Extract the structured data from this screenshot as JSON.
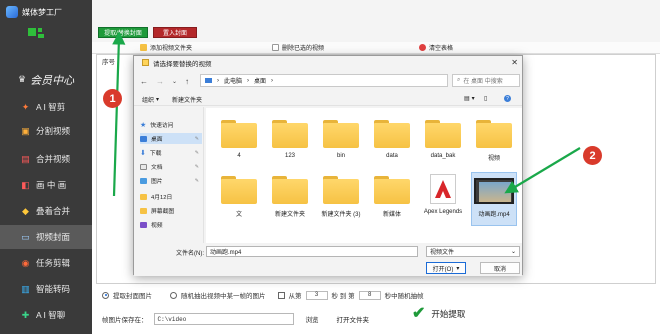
{
  "app": {
    "title": "媒体梦工厂",
    "member_label": "会员中心"
  },
  "sidebar": {
    "items": [
      {
        "label": "A I 智剪",
        "icon": "ai-icon"
      },
      {
        "label": "分割视频",
        "icon": "split-icon"
      },
      {
        "label": "合并视频",
        "icon": "merge-icon"
      },
      {
        "label": "画 中 画",
        "icon": "pip-icon"
      },
      {
        "label": "叠着合并",
        "icon": "stack-icon"
      },
      {
        "label": "视频封面",
        "icon": "cover-icon",
        "active": true
      },
      {
        "label": "任务剪辑",
        "icon": "task-icon"
      },
      {
        "label": "智能转码",
        "icon": "transcode-icon"
      },
      {
        "label": "A I 智聊",
        "icon": "chat-icon"
      }
    ]
  },
  "topbar": {
    "extract_tab": "提取/替换封面",
    "import_tab": "置入封面"
  },
  "toolbar": {
    "add_folder": "添加视频文件夹",
    "delete_selected": "删除已选的视频",
    "clear_table": "清空表格"
  },
  "table": {
    "col_index": "序号"
  },
  "options": {
    "extract_cover": "提取封面图片",
    "random_frame": "随机抽出视频中某一帧的图片",
    "from_label": "从第",
    "from_value": "3",
    "sec_label": "秒 到 第",
    "to_value": "8",
    "random_suffix": "秒中随机抽帧"
  },
  "save": {
    "label": "帧图片保存在：",
    "path": "C:\\video",
    "browse": "浏览",
    "open_folder": "打开文件夹"
  },
  "start": {
    "label": "开始提取"
  },
  "dialog": {
    "title": "请选择要替换的视频",
    "address": [
      "此电脑",
      "桌面"
    ],
    "search_placeholder": "在 桌面 中搜索",
    "organize": "组织",
    "new_folder": "新建文件夹",
    "nav": [
      {
        "label": "快速访问",
        "color": "#3b7ed8"
      },
      {
        "label": "桌面",
        "color": "#3b7ed8",
        "selected": true,
        "pinned": true
      },
      {
        "label": "下载",
        "color": "#3b7ed8",
        "pinned": true
      },
      {
        "label": "文档",
        "color": "#8a8a8a",
        "pinned": true
      },
      {
        "label": "图片",
        "color": "#4a9be0",
        "pinned": true
      },
      {
        "label": "4月12日",
        "color": "#f6c244"
      },
      {
        "label": "屏幕截图",
        "color": "#f6c244"
      },
      {
        "label": "视频",
        "color": "#7b4fc8"
      }
    ],
    "files": [
      {
        "name": "4",
        "type": "folder"
      },
      {
        "name": "123",
        "type": "folder"
      },
      {
        "name": "bin",
        "type": "folder"
      },
      {
        "name": "data",
        "type": "folder"
      },
      {
        "name": "data_bak",
        "type": "folder"
      },
      {
        "name": "视频",
        "type": "folder"
      },
      {
        "name": "文",
        "type": "folder"
      },
      {
        "name": "新建文件夹",
        "type": "folder"
      },
      {
        "name": "新建文件夹 (3)",
        "type": "folder"
      },
      {
        "name": "新媒体",
        "type": "folder"
      },
      {
        "name": "Apex Legends",
        "type": "app"
      },
      {
        "name": "动画跑.mp4",
        "type": "video",
        "selected": true
      }
    ],
    "filename_label": "文件名(N):",
    "filename_value": "动画跑.mp4",
    "filetype": "视频文件",
    "open_button": "打开(O)",
    "cancel_button": "取消"
  },
  "annotations": {
    "step1": "1",
    "step2": "2",
    "arrow_color": "#1aa84a",
    "badge_color": "#d93a2b"
  }
}
